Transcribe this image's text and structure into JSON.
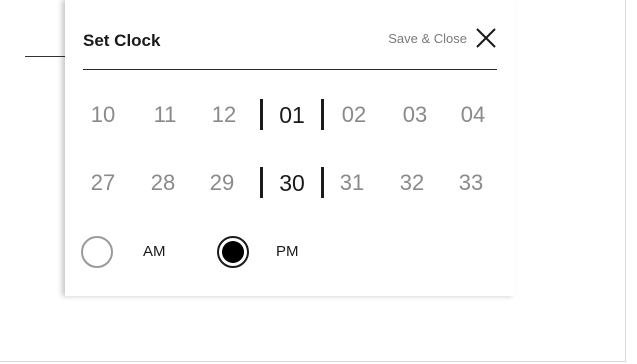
{
  "dialog": {
    "title": "Set Clock",
    "save_close_label": "Save & Close",
    "icons": {
      "close": "close-icon"
    }
  },
  "hours": {
    "options": [
      "10",
      "11",
      "12",
      "01",
      "02",
      "03",
      "04"
    ],
    "selected": "01"
  },
  "minutes": {
    "options": [
      "27",
      "28",
      "29",
      "30",
      "31",
      "32",
      "33"
    ],
    "selected": "30"
  },
  "period": {
    "options": [
      {
        "label": "AM",
        "selected": false
      },
      {
        "label": "PM",
        "selected": true
      }
    ]
  },
  "colors": {
    "text_selected": "#1a1a1a",
    "text_unselected": "#8a8a8a",
    "radio_fill": "#000000"
  }
}
